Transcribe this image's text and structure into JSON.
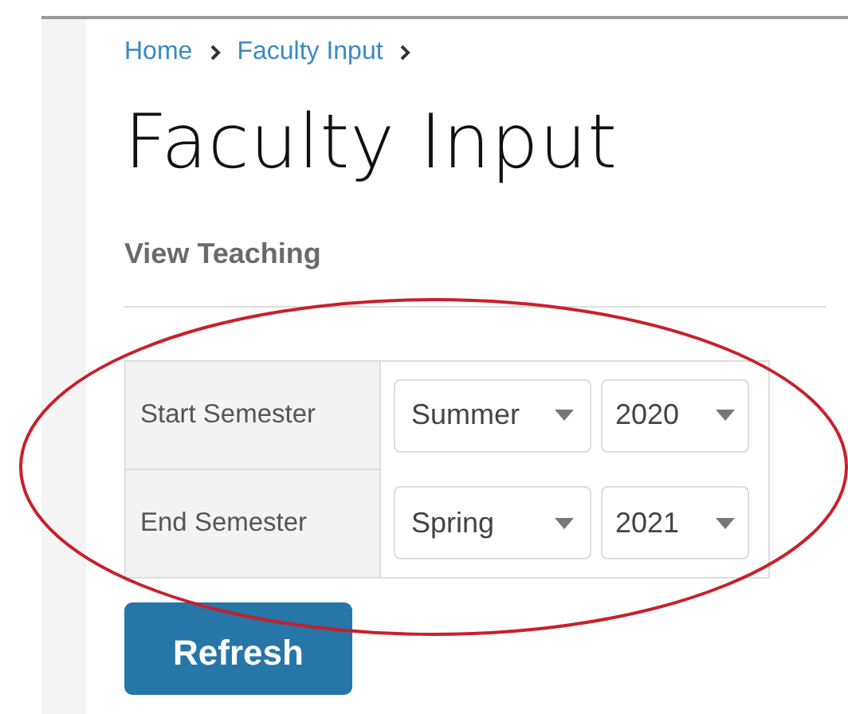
{
  "breadcrumb": [
    {
      "label": "Home"
    },
    {
      "label": "Faculty Input"
    }
  ],
  "title": "Faculty Input",
  "subtitle": "View Teaching",
  "filters": [
    {
      "label": "Start Semester",
      "selects": [
        {
          "value": "Summer"
        },
        {
          "value": "2020"
        }
      ]
    },
    {
      "label": "End Semester",
      "selects": [
        {
          "value": "Spring"
        },
        {
          "value": "2021"
        }
      ]
    }
  ],
  "buttons": [
    {
      "label": "Refresh"
    }
  ]
}
